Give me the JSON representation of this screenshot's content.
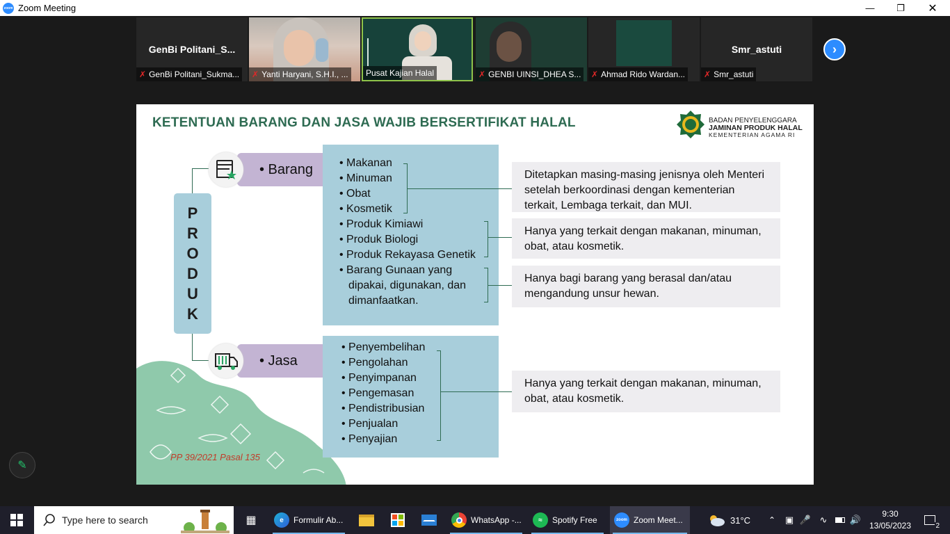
{
  "window": {
    "title": "Zoom Meeting"
  },
  "participants": [
    {
      "display_name": "GenBi  Politani_S...",
      "label": "GenBi Politani_Sukma...",
      "muted": true
    },
    {
      "display_name": "",
      "label": "Yanti Haryani, S.H.I., ...",
      "muted": true
    },
    {
      "display_name": "",
      "label": "Pusat Kajian Halal",
      "muted": false,
      "active": true
    },
    {
      "display_name": "",
      "label": "GENBI UINSI_DHEA S...",
      "muted": true
    },
    {
      "display_name": "",
      "label": "Ahmad Rido Wardan...",
      "muted": true
    },
    {
      "display_name": "Smr_astuti",
      "label": "Smr_astuti",
      "muted": true
    }
  ],
  "slide": {
    "title": "KETENTUAN BARANG DAN JASA WAJIB BERSERTIFIKAT HALAL",
    "logo": {
      "line1": "BADAN PENYELENGGARA",
      "line2": "JAMINAN PRODUK HALAL",
      "line3": "KEMENTERIAN AGAMA RI"
    },
    "produk_letters": [
      "P",
      "R",
      "O",
      "D",
      "U",
      "K"
    ],
    "barang": {
      "label": "• Barang",
      "items": [
        "• Makanan",
        "• Minuman",
        "• Obat",
        "• Kosmetik",
        "• Produk Kimiawi",
        "• Produk Biologi",
        "• Produk Rekayasa Genetik",
        "• Barang Gunaan yang",
        "dipakai, digunakan, dan",
        "dimanfaatkan."
      ]
    },
    "jasa": {
      "label": "• Jasa",
      "items": [
        "• Penyembelihan",
        "• Pengolahan",
        "• Penyimpanan",
        "• Pengemasan",
        "• Pendistribusian",
        "• Penjualan",
        "• Penyajian"
      ]
    },
    "notes": [
      "Ditetapkan masing-masing jenisnya oleh Menteri setelah berkoordinasi dengan kementerian terkait, Lembaga terkait, dan MUI.",
      "Hanya yang terkait dengan makanan, minuman, obat, atau kosmetik.",
      "Hanya bagi barang yang berasal dan/atau mengandung unsur hewan.",
      "Hanya yang terkait dengan makanan, minuman, obat, atau kosmetik."
    ],
    "citation": "PP 39/2021 Pasal 135"
  },
  "taskbar": {
    "search_placeholder": "Type here to search",
    "apps": [
      {
        "label": "Formulir Ab...",
        "icon": "edge-icon"
      },
      {
        "label": "",
        "icon": "file-explorer-icon"
      },
      {
        "label": "",
        "icon": "store-icon"
      },
      {
        "label": "",
        "icon": "mail-icon"
      },
      {
        "label": "WhatsApp -...",
        "icon": "chrome-icon"
      },
      {
        "label": "Spotify Free",
        "icon": "spotify-icon"
      },
      {
        "label": "Zoom Meet...",
        "icon": "zoom-icon",
        "active": true
      }
    ],
    "weather": "31°C",
    "time": "9:30",
    "date": "13/05/2023",
    "notification_count": "2"
  }
}
